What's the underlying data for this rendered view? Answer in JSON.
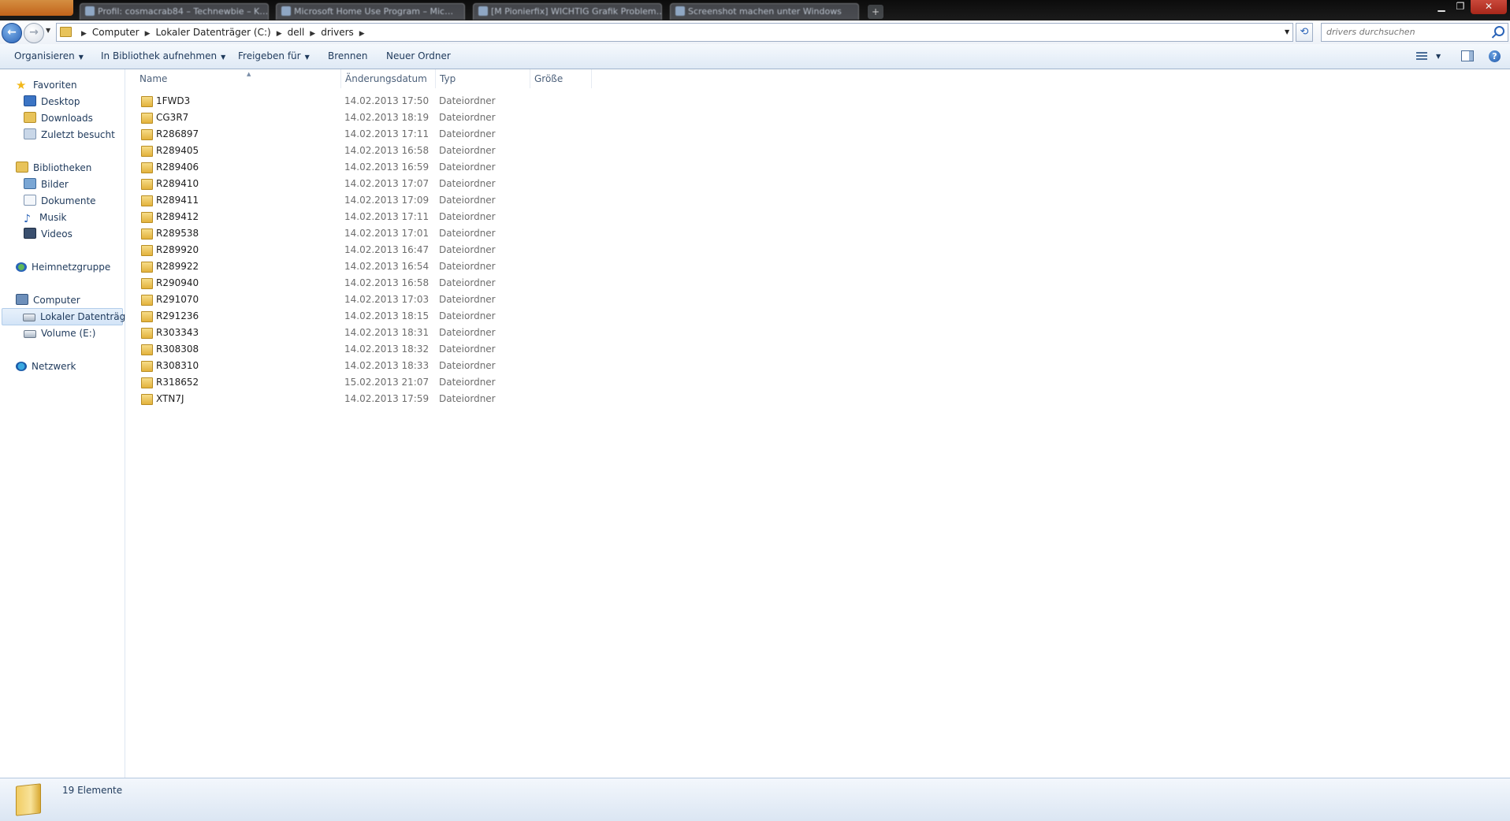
{
  "tabs": [
    "Profil: cosmacrab84 – Technewbie – K…",
    "Microsoft Home Use Program – Mic…",
    "[M Pionierfix] WICHTIG Grafik Problem…",
    "Screenshot machen unter Windows"
  ],
  "address": {
    "crumbs": [
      "Computer",
      "Lokaler Datenträger (C:)",
      "dell",
      "drivers"
    ]
  },
  "search": {
    "placeholder": "drivers durchsuchen"
  },
  "toolbar": {
    "organize": "Organisieren",
    "library": "In Bibliothek aufnehmen",
    "share": "Freigeben für",
    "burn": "Brennen",
    "new_folder": "Neuer Ordner"
  },
  "nav": {
    "favorites": "Favoriten",
    "desktop": "Desktop",
    "downloads": "Downloads",
    "recent": "Zuletzt besucht",
    "libraries": "Bibliotheken",
    "pictures": "Bilder",
    "documents": "Dokumente",
    "music": "Musik",
    "videos": "Videos",
    "homegroup": "Heimnetzgruppe",
    "computer": "Computer",
    "local_disk": "Lokaler Datenträger",
    "volume_e": "Volume (E:)",
    "network": "Netzwerk"
  },
  "columns": {
    "name": "Name",
    "date": "Änderungsdatum",
    "type": "Typ",
    "size": "Größe"
  },
  "files": [
    {
      "name": "1FWD3",
      "date": "14.02.2013 17:50",
      "type": "Dateiordner"
    },
    {
      "name": "CG3R7",
      "date": "14.02.2013 18:19",
      "type": "Dateiordner"
    },
    {
      "name": "R286897",
      "date": "14.02.2013 17:11",
      "type": "Dateiordner"
    },
    {
      "name": "R289405",
      "date": "14.02.2013 16:58",
      "type": "Dateiordner"
    },
    {
      "name": "R289406",
      "date": "14.02.2013 16:59",
      "type": "Dateiordner"
    },
    {
      "name": "R289410",
      "date": "14.02.2013 17:07",
      "type": "Dateiordner"
    },
    {
      "name": "R289411",
      "date": "14.02.2013 17:09",
      "type": "Dateiordner"
    },
    {
      "name": "R289412",
      "date": "14.02.2013 17:11",
      "type": "Dateiordner"
    },
    {
      "name": "R289538",
      "date": "14.02.2013 17:01",
      "type": "Dateiordner"
    },
    {
      "name": "R289920",
      "date": "14.02.2013 16:47",
      "type": "Dateiordner"
    },
    {
      "name": "R289922",
      "date": "14.02.2013 16:54",
      "type": "Dateiordner"
    },
    {
      "name": "R290940",
      "date": "14.02.2013 16:58",
      "type": "Dateiordner"
    },
    {
      "name": "R291070",
      "date": "14.02.2013 17:03",
      "type": "Dateiordner"
    },
    {
      "name": "R291236",
      "date": "14.02.2013 18:15",
      "type": "Dateiordner"
    },
    {
      "name": "R303343",
      "date": "14.02.2013 18:31",
      "type": "Dateiordner"
    },
    {
      "name": "R308308",
      "date": "14.02.2013 18:32",
      "type": "Dateiordner"
    },
    {
      "name": "R308310",
      "date": "14.02.2013 18:33",
      "type": "Dateiordner"
    },
    {
      "name": "R318652",
      "date": "15.02.2013 21:07",
      "type": "Dateiordner"
    },
    {
      "name": "XTN7J",
      "date": "14.02.2013 17:59",
      "type": "Dateiordner"
    }
  ],
  "status": {
    "count": "19 Elemente"
  }
}
